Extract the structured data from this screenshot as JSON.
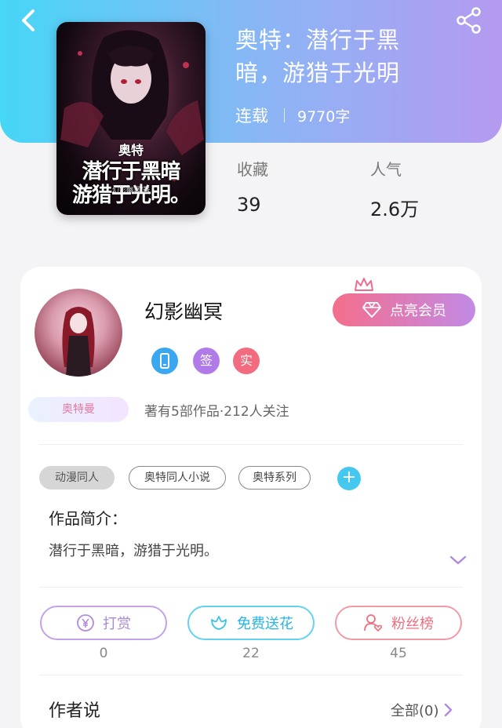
{
  "header": {
    "back_icon": "back-arrow-icon",
    "share_icon": "share-icon",
    "gradient": [
      "#46d6f6",
      "#b59af0"
    ]
  },
  "book": {
    "title": "奥特：潜行于黑暗，游猎于光明",
    "status": "连载",
    "word_count": "9770字",
    "cover": {
      "small_title": "奥特",
      "line1": "潜行于黑暗",
      "line2": "游猎于光明。",
      "author_credit": "幻影幽冥/著"
    },
    "stats": [
      {
        "label": "收藏",
        "value": "39"
      },
      {
        "label": "人气",
        "value": "2.6万"
      }
    ]
  },
  "author": {
    "name": "幻影幽冥",
    "avatar_badge": "奥特曼",
    "vip_button": "点亮会员",
    "badges": [
      {
        "icon": "phone-icon",
        "color": "#3aa7f0"
      },
      {
        "text": "签",
        "color": "#b07be8"
      },
      {
        "text": "实",
        "color": "#f36b7f"
      }
    ],
    "meta": "著有5部作品·212人关注"
  },
  "tags": [
    {
      "label": "动漫同人",
      "style": "filled"
    },
    {
      "label": "奥特同人小说",
      "style": "outline"
    },
    {
      "label": "奥特系列",
      "style": "outline"
    }
  ],
  "synopsis": {
    "title": "作品简介：",
    "text": "潜行于黑暗，游猎于光明。"
  },
  "actions": [
    {
      "label": "打赏",
      "count": "0",
      "icon": "yen-coin-icon",
      "color": "#b38be0"
    },
    {
      "label": "免费送花",
      "count": "22",
      "icon": "flower-icon",
      "color": "#3cc3e8"
    },
    {
      "label": "粉丝榜",
      "count": "45",
      "icon": "user-heart-icon",
      "color": "#ef6f80"
    }
  ],
  "author_says": {
    "title": "作者说",
    "view_all": "全部(0)"
  }
}
